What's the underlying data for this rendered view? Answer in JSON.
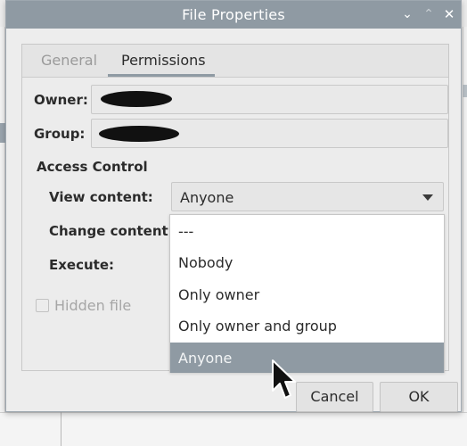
{
  "window": {
    "title": "File Properties",
    "controls": {
      "minimize": "⌄",
      "maximize": "⌃",
      "close": "✕"
    }
  },
  "tabs": [
    {
      "label": "General",
      "active": false
    },
    {
      "label": "Permissions",
      "active": true
    }
  ],
  "owner": {
    "label": "Owner:",
    "value_redacted": true
  },
  "group": {
    "label": "Group:",
    "value_redacted": true
  },
  "access_control": {
    "heading": "Access Control",
    "view_content": {
      "label": "View content:",
      "value": "Anyone"
    },
    "change_content": {
      "label": "Change content:"
    },
    "execute": {
      "label": "Execute:"
    }
  },
  "dropdown": {
    "options": [
      "---",
      "Nobody",
      "Only owner",
      "Only owner and group",
      "Anyone"
    ],
    "highlighted": "Anyone"
  },
  "hidden_file": {
    "label": "Hidden file",
    "checked": false,
    "enabled": false
  },
  "buttons": {
    "cancel": "Cancel",
    "ok": "OK"
  },
  "colors": {
    "titlebar": "#8f9aa3",
    "selection": "#8f9aa3",
    "dialog_bg": "#ededed"
  }
}
